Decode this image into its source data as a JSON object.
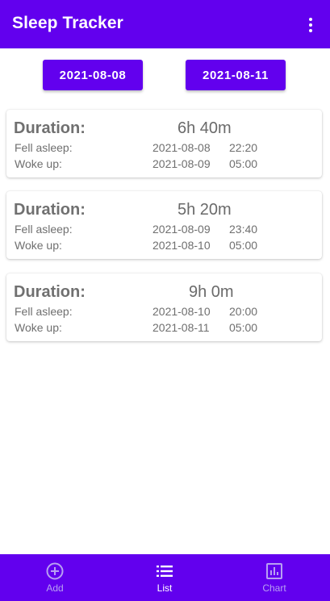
{
  "app": {
    "title": "Sleep Tracker",
    "menu_icon": "more-vert-icon",
    "colors": {
      "primary": "#6200ee",
      "on_primary": "#ffffff",
      "inactive_nav": "#b8a0f2"
    }
  },
  "filter": {
    "start_date": "2021-08-08",
    "end_date": "2021-08-11"
  },
  "labels": {
    "duration": "Duration:",
    "fell_asleep": "Fell asleep:",
    "woke_up": "Woke up:"
  },
  "records": [
    {
      "duration": "6h 40m",
      "asleep_date": "2021-08-08",
      "asleep_time": "22:20",
      "wake_date": "2021-08-09",
      "wake_time": "05:00"
    },
    {
      "duration": "5h 20m",
      "asleep_date": "2021-08-09",
      "asleep_time": "23:40",
      "wake_date": "2021-08-10",
      "wake_time": "05:00"
    },
    {
      "duration": "9h 0m",
      "asleep_date": "2021-08-10",
      "asleep_time": "20:00",
      "wake_date": "2021-08-11",
      "wake_time": "05:00"
    }
  ],
  "nav": [
    {
      "label": "Add",
      "icon": "add-circle-icon",
      "active": false
    },
    {
      "label": "List",
      "icon": "list-icon",
      "active": true
    },
    {
      "label": "Chart",
      "icon": "chart-icon",
      "active": false
    }
  ]
}
